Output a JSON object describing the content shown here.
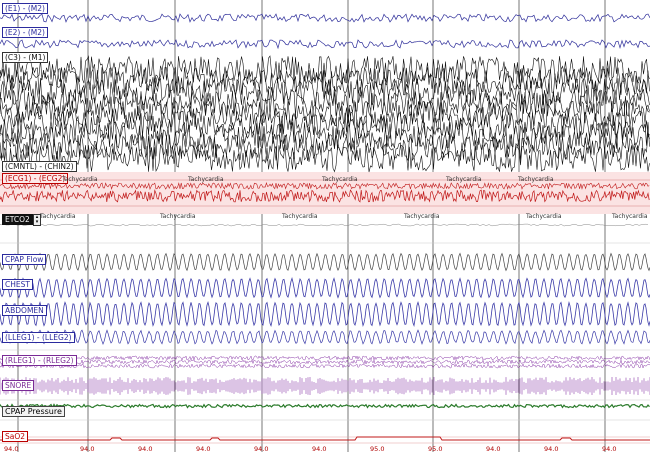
{
  "channels": {
    "e1": "(E1) - (M2)",
    "e2": "(E2) - (M2)",
    "c3": "(C3) - (M1)",
    "mentalis": "(CMNTL) - (CHIN2)",
    "ecg": "(ECG1) - (ECG2)",
    "etco2": "ETCO2",
    "cpap_flow": "CPAP Flow",
    "chest": "CHEST",
    "abdomen": "ABDOMEN",
    "leg_left": "(LLEG1) - (LLEG2)",
    "leg_right": "(RLEG1) - (RLEG2)",
    "snore": "SNORE",
    "cpap_pressure": "CPAP Pressure",
    "sao2": "SaO2"
  },
  "events": {
    "tachycardia": "Tachycardia"
  },
  "sleep_stage": "N2",
  "spo2_values": [
    "94.0",
    "94.0",
    "94.0",
    "94.0",
    "94.0",
    "94.0",
    "95.0",
    "95.0",
    "94.0",
    "94.0",
    "94.0"
  ],
  "colors": {
    "eeg": "#2e2e9a",
    "eeg_dense": "#111111",
    "ecg": "#c01818",
    "resp": "#3a3aa8",
    "leg": "#8a3aa8",
    "cpap": "#2a7a2a",
    "sao2": "#c01818"
  }
}
